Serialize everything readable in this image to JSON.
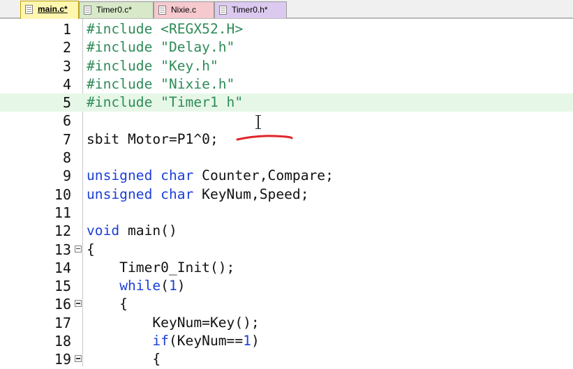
{
  "tabs": [
    {
      "label": "main.c*",
      "active": true,
      "bg": "#fff7b0"
    },
    {
      "label": "Timer0.c*",
      "active": false,
      "bg": "#d7e9c8"
    },
    {
      "label": "Nixie.c",
      "active": false,
      "bg": "#f6c9cf"
    },
    {
      "label": "Timer0.h*",
      "active": false,
      "bg": "#dcc9f0"
    }
  ],
  "editor": {
    "highlight_line": 5,
    "lines": [
      {
        "n": "1",
        "segs": [
          {
            "t": "#include <REGX52.H>",
            "c": "pp"
          }
        ]
      },
      {
        "n": "2",
        "segs": [
          {
            "t": "#include \"Delay.h\"",
            "c": "pp"
          }
        ]
      },
      {
        "n": "3",
        "segs": [
          {
            "t": "#include \"Key.h\"",
            "c": "pp"
          }
        ]
      },
      {
        "n": "4",
        "segs": [
          {
            "t": "#include \"Nixie.h\"",
            "c": "pp"
          }
        ]
      },
      {
        "n": "5",
        "segs": [
          {
            "t": "#include \"Timer1 h\"",
            "c": "pp"
          }
        ]
      },
      {
        "n": "6",
        "segs": []
      },
      {
        "n": "7",
        "segs": [
          {
            "t": "sbit Motor=P1^0;",
            "c": ""
          }
        ]
      },
      {
        "n": "8",
        "segs": []
      },
      {
        "n": "9",
        "segs": [
          {
            "t": "unsigned",
            "c": "kw"
          },
          {
            "t": " ",
            "c": ""
          },
          {
            "t": "char",
            "c": "kw"
          },
          {
            "t": " Counter,Compare;",
            "c": ""
          }
        ]
      },
      {
        "n": "10",
        "segs": [
          {
            "t": "unsigned",
            "c": "kw"
          },
          {
            "t": " ",
            "c": ""
          },
          {
            "t": "char",
            "c": "kw"
          },
          {
            "t": " KeyNum,Speed;",
            "c": ""
          }
        ]
      },
      {
        "n": "11",
        "segs": []
      },
      {
        "n": "12",
        "segs": [
          {
            "t": "void",
            "c": "kw"
          },
          {
            "t": " main()",
            "c": ""
          }
        ]
      },
      {
        "n": "13",
        "fold": true,
        "segs": [
          {
            "t": "{",
            "c": ""
          }
        ]
      },
      {
        "n": "14",
        "segs": [
          {
            "t": "    Timer0_Init();",
            "c": ""
          }
        ]
      },
      {
        "n": "15",
        "segs": [
          {
            "t": "    ",
            "c": ""
          },
          {
            "t": "while",
            "c": "kw"
          },
          {
            "t": "(",
            "c": ""
          },
          {
            "t": "1",
            "c": "num"
          },
          {
            "t": ")",
            "c": ""
          }
        ]
      },
      {
        "n": "16",
        "fold": true,
        "segs": [
          {
            "t": "    {",
            "c": ""
          }
        ]
      },
      {
        "n": "17",
        "segs": [
          {
            "t": "        KeyNum=Key();",
            "c": ""
          }
        ]
      },
      {
        "n": "18",
        "segs": [
          {
            "t": "        ",
            "c": ""
          },
          {
            "t": "if",
            "c": "kw"
          },
          {
            "t": "(KeyNum==",
            "c": ""
          },
          {
            "t": "1",
            "c": "num"
          },
          {
            "t": ")",
            "c": ""
          }
        ]
      },
      {
        "n": "19",
        "fold": true,
        "segs": [
          {
            "t": "        {",
            "c": ""
          }
        ]
      }
    ]
  },
  "colors": {
    "preprocessor": "#2e8b57",
    "keyword": "#1a3fd6",
    "current_line": "#e6f7e8",
    "annotation": "#e0252a"
  }
}
